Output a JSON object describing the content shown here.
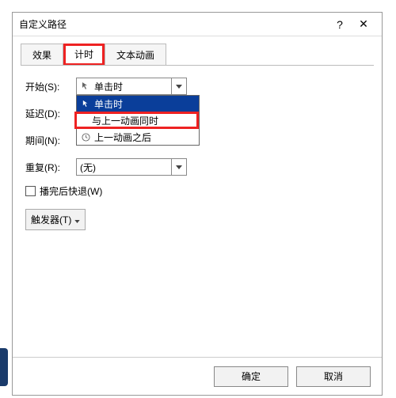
{
  "dialog": {
    "title": "自定义路径",
    "help": "?",
    "close": "✕"
  },
  "tabs": {
    "effect": "效果",
    "timing": "计时",
    "textanim": "文本动画"
  },
  "labels": {
    "start": "开始(S):",
    "delay": "延迟(D):",
    "duration": "期间(N):",
    "repeat": "重复(R):"
  },
  "combos": {
    "start_selected": "单击时",
    "repeat_selected": "(无)"
  },
  "dropdown": {
    "opt1": "单击时",
    "opt2": "与上一动画同时",
    "opt3": "上一动画之后"
  },
  "checkbox": {
    "rewind": "播完后快退(W)"
  },
  "trigger": {
    "label": "触发器(T)"
  },
  "footer": {
    "ok": "确定",
    "cancel": "取消"
  }
}
